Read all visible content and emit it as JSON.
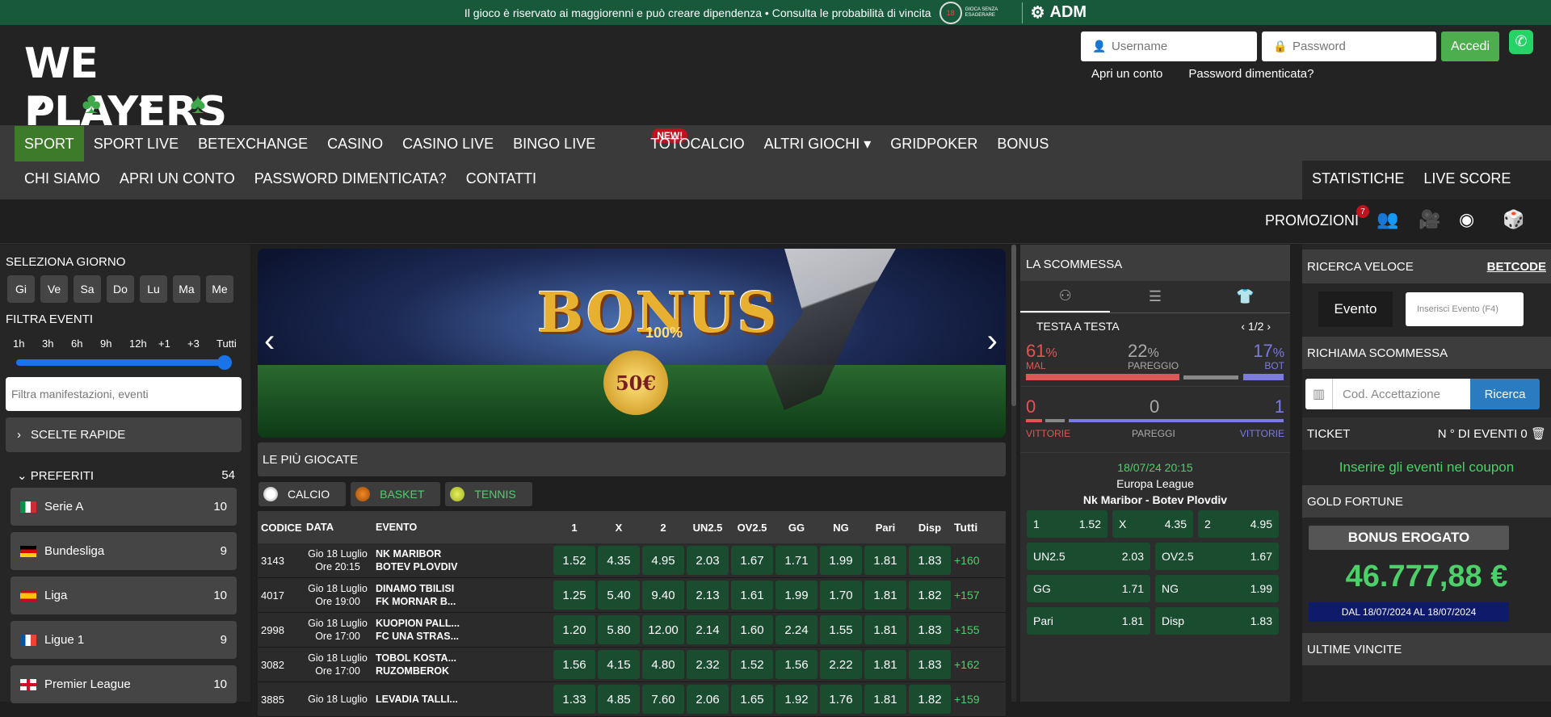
{
  "topbar": {
    "notice": "Il gioco è riservato ai maggiorenni e può creare dipendenza • Consulta le probabilità di vincita",
    "age": "18",
    "age_small": "GIOCA SENZA ESAGERARE",
    "adm": "ADM"
  },
  "logo": {
    "text": "WE PLAYERS",
    "suits": [
      "♥",
      "♣",
      "♦",
      "♠"
    ]
  },
  "login": {
    "username_placeholder": "Username",
    "password_placeholder": "Password",
    "button": "Accedi",
    "open_account": "Apri un conto",
    "forgot": "Password dimenticata?"
  },
  "nav": {
    "row1": [
      "SPORT",
      "SPORT LIVE",
      "BETEXCHANGE",
      "CASINO",
      "CASINO LIVE",
      "BINGO LIVE",
      "TOTOCALCIO",
      "ALTRI GIOCHI ▾",
      "GRIDPOKER",
      "BONUS"
    ],
    "new_badge": "NEW!",
    "row2": [
      "CHI SIAMO",
      "APRI UN CONTO",
      "PASSWORD DIMENTICATA?",
      "CONTATTI"
    ],
    "right": [
      "STATISTICHE",
      "LIVE SCORE"
    ]
  },
  "promo": {
    "label": "PROMOZIONI",
    "count": "7"
  },
  "sidebar": {
    "select_day": "SELEZIONA GIORNO",
    "days": [
      "Gi",
      "Ve",
      "Sa",
      "Do",
      "Lu",
      "Ma",
      "Me"
    ],
    "filter_events": "FILTRA EVENTI",
    "hours": [
      "1h",
      "3h",
      "6h",
      "9h",
      "12h",
      "+1",
      "+3",
      "Tutti"
    ],
    "filter_placeholder": "Filtra manifestazioni, eventi",
    "quick": "SCELTE RAPIDE",
    "favorites": "PREFERITI",
    "favorites_count": "54",
    "leagues": [
      {
        "name": "Serie A",
        "count": "10"
      },
      {
        "name": "Bundesliga",
        "count": "9"
      },
      {
        "name": "Liga",
        "count": "10"
      },
      {
        "name": "Ligue 1",
        "count": "9"
      },
      {
        "name": "Premier League",
        "count": "10"
      }
    ]
  },
  "banner": {
    "title": "BONUS",
    "sub": "100%",
    "coin": "50€"
  },
  "most_played": "LE PIÙ GIOCATE",
  "sports": [
    "CALCIO",
    "BASKET",
    "TENNIS"
  ],
  "table": {
    "headers": [
      "CODICE",
      "DATA",
      "EVENTO",
      "1",
      "X",
      "2",
      "UN2.5",
      "OV2.5",
      "GG",
      "NG",
      "Pari",
      "Disp",
      "Tutti"
    ],
    "rows": [
      {
        "code": "3143",
        "d1": "Gio 18 Luglio",
        "d2": "Ore 20:15",
        "e1": "NK MARIBOR",
        "e2": "BOTEV PLOVDIV",
        "odds": [
          "1.52",
          "4.35",
          "4.95",
          "2.03",
          "1.67",
          "1.71",
          "1.99",
          "1.81",
          "1.83"
        ],
        "tot": "+160"
      },
      {
        "code": "4017",
        "d1": "Gio 18 Luglio",
        "d2": "Ore 19:00",
        "e1": "DINAMO TBILISI",
        "e2": "FK MORNAR B...",
        "odds": [
          "1.25",
          "5.40",
          "9.40",
          "2.13",
          "1.61",
          "1.99",
          "1.70",
          "1.81",
          "1.82"
        ],
        "tot": "+157"
      },
      {
        "code": "2998",
        "d1": "Gio 18 Luglio",
        "d2": "Ore 17:00",
        "e1": "KUOPION PALL...",
        "e2": "FC UNA STRAS...",
        "odds": [
          "1.20",
          "5.80",
          "12.00",
          "2.14",
          "1.60",
          "2.24",
          "1.55",
          "1.81",
          "1.83"
        ],
        "tot": "+155"
      },
      {
        "code": "3082",
        "d1": "Gio 18 Luglio",
        "d2": "Ore 17:00",
        "e1": "TOBOL KOSTA...",
        "e2": "RUZOMBEROK",
        "odds": [
          "1.56",
          "4.15",
          "4.80",
          "2.32",
          "1.52",
          "1.56",
          "2.22",
          "1.81",
          "1.83"
        ],
        "tot": "+162"
      },
      {
        "code": "3885",
        "d1": "Gio 18 Luglio",
        "d2": "",
        "e1": "LEVADIA TALLI...",
        "e2": "",
        "odds": [
          "1.33",
          "4.85",
          "7.60",
          "2.06",
          "1.65",
          "1.92",
          "1.76",
          "1.81",
          "1.82"
        ],
        "tot": "+159"
      }
    ]
  },
  "bet": {
    "title": "LA SCOMMESSA",
    "tat": "TESTA A TESTA",
    "page": "1/2",
    "p1": "61",
    "p1l": "MAL",
    "px": "22",
    "pxl": "PAREGGIO",
    "p2": "17",
    "p2l": "BOT",
    "pct_sign": "%",
    "w1": "0",
    "w1l": "VITTORIE",
    "wx": "0",
    "wxl": "PAREGGI",
    "w2": "1",
    "w2l": "VITTORIE",
    "when": "18/07/24 20:15",
    "comp": "Europa League",
    "match": "Nk Maribor - Botev Plovdiv",
    "odds": [
      {
        "k": "1",
        "v": "1.52"
      },
      {
        "k": "X",
        "v": "4.35"
      },
      {
        "k": "2",
        "v": "4.95"
      },
      {
        "k": "UN2.5",
        "v": "2.03"
      },
      {
        "k": "OV2.5",
        "v": "1.67"
      },
      {
        "k": "GG",
        "v": "1.71"
      },
      {
        "k": "NG",
        "v": "1.99"
      },
      {
        "k": "Pari",
        "v": "1.81"
      },
      {
        "k": "Disp",
        "v": "1.83"
      }
    ]
  },
  "right": {
    "quick_search": "RICERCA VELOCE",
    "betcode": "BETCODE",
    "evento": "Evento",
    "evento_placeholder": "Inserisci Evento (F4)",
    "recall": "RICHIAMA SCOMMESSA",
    "acc_placeholder": "Cod. Accettazione",
    "search_btn": "Ricerca",
    "ticket": "TICKET",
    "events_count": "N ° DI EVENTI 0",
    "coupon_msg": "Inserire gli eventi nel coupon",
    "gold": "GOLD FORTUNE",
    "bonus_paid": "BONUS EROGATO",
    "amount": "46.777,88 €",
    "dal": "DAL 18/07/2024 AL 18/07/2024",
    "last_wins": "ULTIME VINCITE"
  }
}
